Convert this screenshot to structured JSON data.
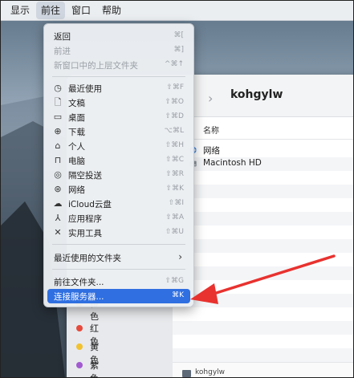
{
  "menubar": {
    "items": [
      "显示",
      "前往",
      "窗口",
      "帮助"
    ]
  },
  "finder": {
    "title": "kohgylw",
    "column_name": "名称",
    "files": [
      {
        "name": "网络",
        "icon": "globe-icon"
      },
      {
        "name": "Macintosh HD",
        "icon": "disk-icon"
      }
    ],
    "path_label": "kohgylw",
    "sidebar_tags": [
      {
        "label": "橙色",
        "color": "#f5a623"
      },
      {
        "label": "红色",
        "color": "#e64a3c"
      },
      {
        "label": "黄色",
        "color": "#f2c12e"
      },
      {
        "label": "紫色",
        "color": "#a25ad0"
      }
    ]
  },
  "go_menu": {
    "top_items": [
      {
        "label": "返回",
        "shortcut": "⌘[",
        "disabled": false
      },
      {
        "label": "前进",
        "shortcut": "⌘]",
        "disabled": true
      },
      {
        "label": "新窗口中的上层文件夹",
        "shortcut": "^⌘↑",
        "disabled": true
      }
    ],
    "places": [
      {
        "label": "最近使用",
        "shortcut": "⇧⌘F",
        "icon": "clock-icon"
      },
      {
        "label": "文稿",
        "shortcut": "⇧⌘O",
        "icon": "document-icon"
      },
      {
        "label": "桌面",
        "shortcut": "⇧⌘D",
        "icon": "desktop-icon"
      },
      {
        "label": "下载",
        "shortcut": "⌥⌘L",
        "icon": "download-icon"
      },
      {
        "label": "个人",
        "shortcut": "⇧⌘H",
        "icon": "home-icon"
      },
      {
        "label": "电脑",
        "shortcut": "⇧⌘C",
        "icon": "computer-icon"
      },
      {
        "label": "隔空投送",
        "shortcut": "⇧⌘R",
        "icon": "airdrop-icon"
      },
      {
        "label": "网络",
        "shortcut": "⇧⌘K",
        "icon": "network-icon"
      },
      {
        "label": "iCloud云盘",
        "shortcut": "⇧⌘I",
        "icon": "cloud-icon"
      },
      {
        "label": "应用程序",
        "shortcut": "⇧⌘A",
        "icon": "applications-icon"
      },
      {
        "label": "实用工具",
        "shortcut": "⇧⌘U",
        "icon": "utilities-icon"
      }
    ],
    "recent_folders": {
      "label": "最近使用的文件夹",
      "arrow": "›"
    },
    "goto_folder": {
      "label": "前往文件夹...",
      "shortcut": "⇧⌘G"
    },
    "connect_server": {
      "label": "连接服务器...",
      "shortcut": "⌘K",
      "highlighted": true
    }
  },
  "colors": {
    "highlight": "#2f6fe1",
    "annotation_arrow": "#e8322f"
  }
}
